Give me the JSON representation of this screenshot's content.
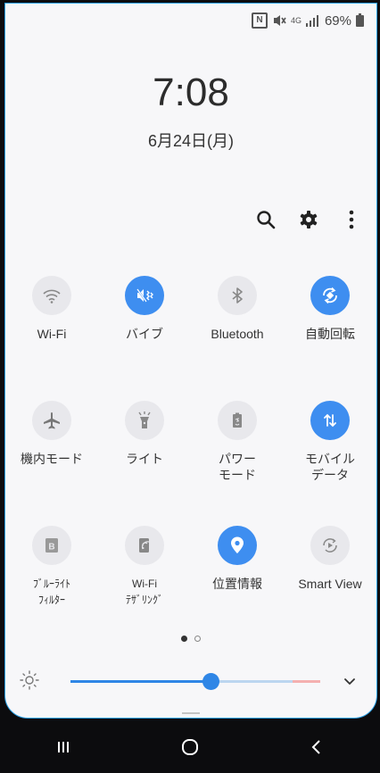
{
  "status_bar": {
    "battery": "69%",
    "network": "4G"
  },
  "clock": {
    "time": "7:08",
    "date": "6月24日(月)"
  },
  "toolbar": {
    "items": [
      "search-icon",
      "gear-icon",
      "more-vert-icon"
    ]
  },
  "tiles": [
    {
      "label": "Wi-Fi",
      "icon": "wifi-icon",
      "on": false
    },
    {
      "label": "バイブ",
      "icon": "vibrate-icon",
      "on": true
    },
    {
      "label": "Bluetooth",
      "icon": "bluetooth-icon",
      "on": false
    },
    {
      "label": "自動回転",
      "icon": "auto-rotate-icon",
      "on": true
    },
    {
      "label": "機内モード",
      "icon": "airplane-icon",
      "on": false
    },
    {
      "label": "ライト",
      "icon": "flashlight-icon",
      "on": false
    },
    {
      "label": "パワー\nモード",
      "icon": "power-mode-icon",
      "on": false
    },
    {
      "label": "モバイル\nデータ",
      "icon": "mobile-data-icon",
      "on": true
    },
    {
      "label": "ﾌﾞﾙｰﾗｲﾄ\nﾌｨﾙﾀｰ",
      "icon": "blue-light-icon",
      "on": false
    },
    {
      "label": "Wi-Fi\nﾃｻﾞﾘﾝｸﾞ",
      "icon": "hotspot-icon",
      "on": false
    },
    {
      "label": "位置情報",
      "icon": "location-icon",
      "on": true
    },
    {
      "label": "Smart View",
      "icon": "smart-view-icon",
      "on": false
    }
  ],
  "page_indicator": {
    "current": 1,
    "total": 2
  },
  "brightness": {
    "level": 0.56,
    "warm_start": 0.89
  },
  "colors": {
    "accent": "#3e8ef0",
    "tile_off": "#e8e8ec",
    "panel_bg": "#f7f7f9",
    "nav_bg": "#0c0c0e"
  },
  "nav": [
    "recent-apps-icon",
    "home-icon",
    "back-icon"
  ]
}
